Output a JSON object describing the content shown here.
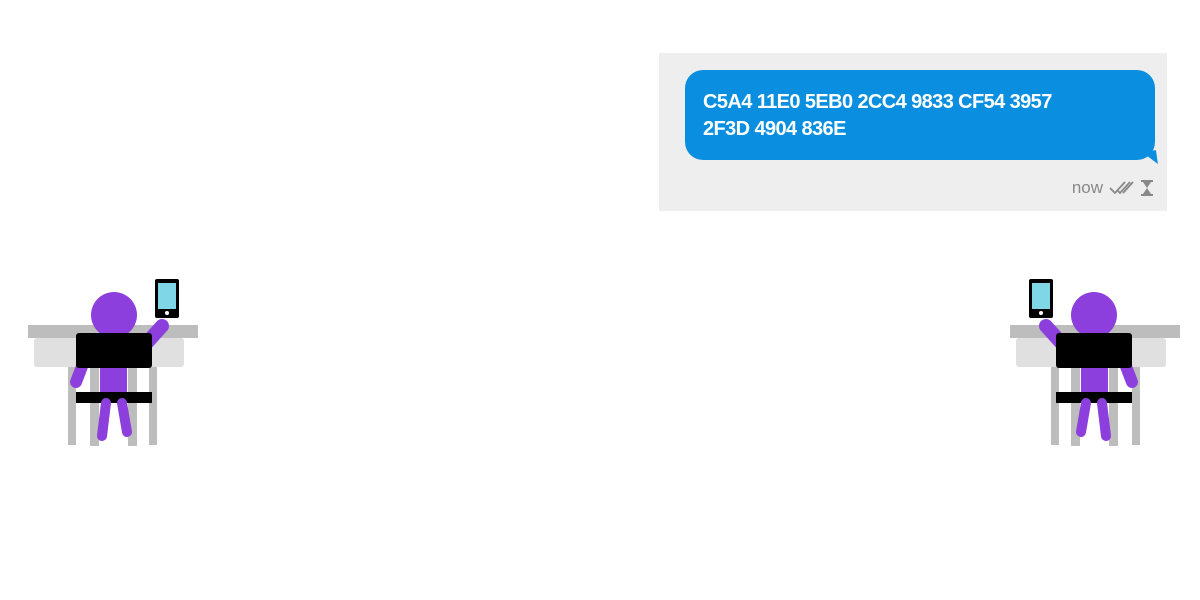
{
  "message": {
    "lines": [
      "C5A4 11E0 5EB0 2CC4 9833 CF54 3957",
      "2F3D 4904 836E"
    ],
    "timestamp": "now",
    "status_icons": [
      "double-check-icon",
      "hourglass-icon"
    ]
  },
  "scene": {
    "people": [
      {
        "side": "left",
        "icon": "person-at-desk-with-phone-icon"
      },
      {
        "side": "right",
        "icon": "person-at-desk-with-phone-icon"
      }
    ]
  },
  "colors": {
    "bubble": "#0a8fe0",
    "panel": "#eeeeee",
    "person": "#8c3fdc",
    "phone_screen": "#7fd6e6",
    "desk": "#bdbdbd"
  }
}
